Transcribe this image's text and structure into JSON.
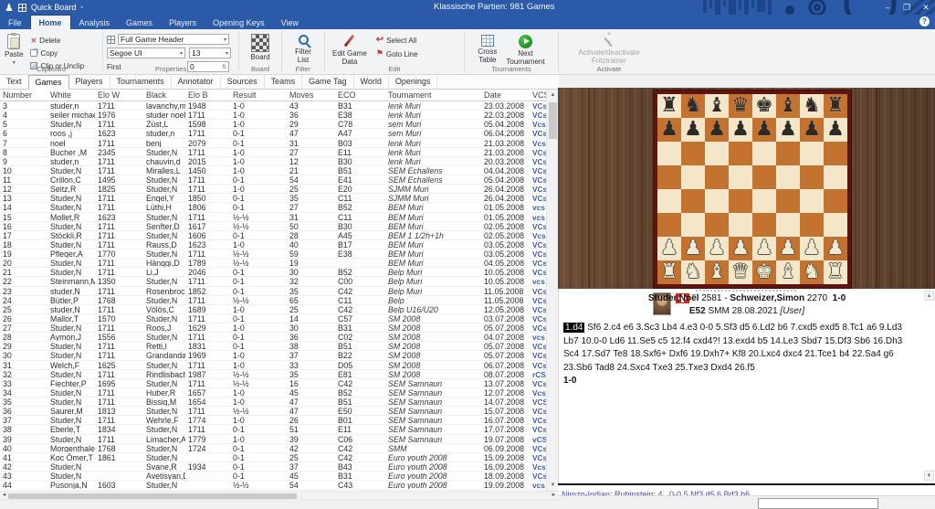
{
  "titlebar": {
    "app_title": "Quick Board",
    "doc_title": "Klassische Partien:  981 Games",
    "minimize": "–",
    "restore": "❐",
    "close": "✕",
    "help": "?"
  },
  "ribbon": {
    "tabs": [
      "File",
      "Home",
      "Analysis",
      "Games",
      "Players",
      "Opening Keys",
      "View"
    ],
    "clipboard": {
      "group": "Clipboard",
      "paste": "Paste",
      "delete": "Delete",
      "copy": "Copy",
      "clip": "Clip or Unclip"
    },
    "properties": {
      "group": "Properties",
      "header_combo": "Full Game Header",
      "font_combo": "Segoe UI",
      "size_combo": "13",
      "first_label": "First",
      "first_value": "0"
    },
    "board": {
      "group": "Board",
      "button": "Board"
    },
    "filter": {
      "group": "Filter",
      "line1": "Filter",
      "line2": "List"
    },
    "edit": {
      "group": "Edit",
      "egd1": "Edit Game",
      "egd2": "Data",
      "select_all": "Select All",
      "goto_line": "Goto Line"
    },
    "tournaments": {
      "group": "Tournaments",
      "ct1": "Cross",
      "ct2": "Table",
      "nt1": "Next",
      "nt2": "Tournament"
    },
    "activate": {
      "group": "Activate",
      "line1": "Activate/deactivate",
      "line2": "Fritztrainer"
    }
  },
  "list_tabs": {
    "items": [
      "Text",
      "Games",
      "Players",
      "Tournaments",
      "Annotator",
      "Sources",
      "Teams",
      "Game Tag",
      "World",
      "Openings"
    ]
  },
  "games_table": {
    "columns": [
      "Number",
      "White",
      "Elo W",
      "Black",
      "Elo B",
      "Result",
      "Moves",
      "ECO",
      "Tournament",
      "Date",
      "VCS"
    ],
    "rows": [
      [
        "3",
        "studer,n",
        "1711",
        "lavanchy,m",
        "1948",
        "1-0",
        "43",
        "B31",
        "lenk Muri",
        "23.03.2008",
        "VCs"
      ],
      [
        "4",
        "seiler michael",
        "1976",
        "studer noel",
        "1711",
        "1-0",
        "36",
        "E38",
        "lenk Muri",
        "22.03.2008",
        "VCs"
      ],
      [
        "5",
        "Studer,N",
        "1711",
        "Züst,L",
        "1598",
        "1-0",
        "29",
        "C78",
        "sem Muri",
        "05.04.2008",
        "Vcs"
      ],
      [
        "6",
        "roos ,j",
        "1623",
        "studer,n",
        "1711",
        "0-1",
        "47",
        "A47",
        "sem Muri",
        "06.04.2008",
        "VCs"
      ],
      [
        "7",
        "noel",
        "1711",
        "benj",
        "2079",
        "0-1",
        "31",
        "B03",
        "lenk Muri",
        "21.03.2008",
        "Vcs"
      ],
      [
        "8",
        "Bucher ,M",
        "2345",
        "Studer,N",
        "1711",
        "1-0",
        "27",
        "E11",
        "lenk Muri",
        "21.03.2008",
        "VCs"
      ],
      [
        "9",
        "studer,n",
        "1711",
        "chauvin,d",
        "2015",
        "1-0",
        "12",
        "B30",
        "lenk Muri",
        "20.03.2008",
        "VCs"
      ],
      [
        "10",
        "Studer,N",
        "1711",
        "Miralles,L",
        "1450",
        "1-0",
        "21",
        "B51",
        "SEM Echallens",
        "04.04.2008",
        "VCs"
      ],
      [
        "11",
        "Crillon,C",
        "1495",
        "Studer,N",
        "1711",
        "0-1",
        "54",
        "E41",
        "SEM Echallens",
        "05.04.2008",
        "VCs"
      ],
      [
        "12",
        "Seitz,R",
        "1825",
        "Studer,N",
        "1711",
        "1-0",
        "25",
        "E20",
        "SJMM Muri",
        "26.04.2008",
        "VCs"
      ],
      [
        "13",
        "Studer,N",
        "1711",
        "Engel,Y",
        "1850",
        "0-1",
        "35",
        "C11",
        "SJMM Muri",
        "26.04.2008",
        "VCs"
      ],
      [
        "14",
        "Studer,N",
        "1711",
        "Lüthi,H",
        "1806",
        "0-1",
        "27",
        "B52",
        "BEM Muri",
        "01.05.2008",
        "vcs"
      ],
      [
        "15",
        "Mollet,R",
        "1623",
        "Studer,N",
        "1711",
        "½-½",
        "31",
        "C11",
        "BEM Muri",
        "01.05.2008",
        "vcs"
      ],
      [
        "16",
        "Studer,N",
        "1711",
        "Senfter,D",
        "1617",
        "½-½",
        "50",
        "B30",
        "BEM Muri",
        "02.05.2008",
        "VCs"
      ],
      [
        "17",
        "Stöckli,R",
        "1711",
        "Studer,N",
        "1606",
        "0-1",
        "28",
        "A45",
        "BEM 1 1/2h+1h",
        "02.05.2008",
        "Vcs"
      ],
      [
        "18",
        "Studer,N",
        "1711",
        "Rauss,D",
        "1623",
        "1-0",
        "40",
        "B17",
        "BEM Muri",
        "03.05.2008",
        "VCs"
      ],
      [
        "19",
        "Pfleger,A",
        "1770",
        "Studer,N",
        "1711",
        "½-½",
        "59",
        "E38",
        "BEM Muri",
        "03.05.2008",
        "VCs"
      ],
      [
        "20",
        "Studer,N",
        "1711",
        "Hänggi,D",
        "1789",
        "½-½",
        "19",
        "",
        "BEM Muri",
        "04.05.2008",
        "VCs"
      ],
      [
        "21",
        "Studer,N",
        "1711",
        "Li,J",
        "2046",
        "0-1",
        "30",
        "B52",
        "Belp Muri",
        "10.05.2008",
        "VCs"
      ],
      [
        "22",
        "Steinmann,M",
        "1350",
        "Studer,N",
        "1711",
        "0-1",
        "32",
        "C00",
        "Belp Muri",
        "10.05.2008",
        "vcs"
      ],
      [
        "23",
        "studer,N",
        "1711",
        "Rosenbrock,T",
        "1852",
        "0-1",
        "35",
        "C42",
        "Belp Muri",
        "11.05.2008",
        "VCs"
      ],
      [
        "24",
        "Bütler,P",
        "1768",
        "Studer,N",
        "1711",
        "½-½",
        "65",
        "C11",
        "Belp",
        "11.05.2008",
        "VCs"
      ],
      [
        "25",
        "studer,N",
        "1711",
        "Völös,C",
        "1689",
        "1-0",
        "25",
        "C42",
        "Belp U16/U20",
        "12.05.2008",
        "VCs"
      ],
      [
        "26",
        "Mallor,T",
        "1570",
        "Studer,N",
        "1711",
        "0-1",
        "14",
        "C57",
        "SM 2008",
        "03.07.2008",
        "VCs"
      ],
      [
        "27",
        "Studer,N",
        "1711",
        "Roos,J",
        "1629",
        "1-0",
        "30",
        "B31",
        "SM 2008",
        "05.07.2008",
        "VCs"
      ],
      [
        "28",
        "Aymon,J",
        "1556",
        "Studer,N",
        "1711",
        "0-1",
        "36",
        "C02",
        "SM 2008",
        "04.07.2008",
        "vcs"
      ],
      [
        "29",
        "Studer,N",
        "1711",
        "Retti,I",
        "1831",
        "0-1",
        "38",
        "B51",
        "SM 2008",
        "05.07.2008",
        "VCs"
      ],
      [
        "30",
        "Studer,N",
        "1711",
        "Grandandam,P",
        "1969",
        "1-0",
        "37",
        "B22",
        "SM 2008",
        "05.07.2008",
        "VCs"
      ],
      [
        "31",
        "Welch,F",
        "1625",
        "Studer,N",
        "1711",
        "1-0",
        "33",
        "D05",
        "SM 2008",
        "06.07.2008",
        "VCs"
      ],
      [
        "32",
        "Studer,N",
        "1711",
        "Rindlisbacher,L",
        "1987",
        "½-½",
        "35",
        "E81",
        "SM 2008",
        "08.07.2008",
        "rCS"
      ],
      [
        "33",
        "Fiechter,P",
        "1695",
        "Studer,N",
        "1711",
        "½-½",
        "16",
        "C42",
        "SEM Samnaun",
        "13.07.2008",
        "VCs"
      ],
      [
        "34",
        "Studer,N",
        "1711",
        "Huber,R",
        "1657",
        "1-0",
        "45",
        "B52",
        "SEM Samnaun",
        "12.07.2008",
        "Vcs"
      ],
      [
        "35",
        "Studer,N",
        "1711",
        "Bissig,M",
        "1654",
        "1-0",
        "47",
        "B51",
        "SEM Samnaun",
        "14.07.2008",
        "VCS"
      ],
      [
        "36",
        "Saurer,M",
        "1813",
        "Studer,N",
        "1711",
        "½-½",
        "47",
        "E50",
        "SEM Samnaun",
        "15.07.2008",
        "VCs"
      ],
      [
        "37",
        "Studer,N",
        "1711",
        "Wehrle,F",
        "1774",
        "1-0",
        "26",
        "B01",
        "SEM Samnaun",
        "16.07.2008",
        "VCs"
      ],
      [
        "38",
        "Eberle,T",
        "1834",
        "Studer,N",
        "1711",
        "0-1",
        "51",
        "E11",
        "SEM Samnaun",
        "17.07.2008",
        "VCs"
      ],
      [
        "39",
        "Studer,N",
        "1711",
        "Limacher,A",
        "1779",
        "1-0",
        "39",
        "C06",
        "SEM Samnaun",
        "19.07.2008",
        "vCS"
      ],
      [
        "40",
        "Morgenthaler,S",
        "1768",
        "Studer,N",
        "1724",
        "0-1",
        "42",
        "C42",
        "SMM",
        "06.09.2008",
        "VCs"
      ],
      [
        "41",
        "Koc Ömer,T",
        "1861",
        "Studer,N",
        "",
        "0-1",
        "25",
        "C42",
        "Euro youth 2008",
        "15.09.2008",
        "VCs"
      ],
      [
        "42",
        "Studer,N",
        "",
        "Svane,R",
        "1934",
        "0-1",
        "37",
        "B43",
        "Euro youth 2008",
        "16.09.2008",
        "Vcs"
      ],
      [
        "43",
        "Studer,N",
        "",
        "Avetisyan,D",
        "",
        "0-1",
        "45",
        "B31",
        "Euro youth 2008",
        "18.09.2008",
        "VCs"
      ],
      [
        "44",
        "Pusonja,N",
        "1603",
        "Studer,N",
        "",
        "½-½",
        "54",
        "C43",
        "Euro youth 2008",
        "19.09.2008",
        "vcs"
      ]
    ]
  },
  "board_panel": {
    "ranks": [
      "rnbqkbnr",
      "pppppppp",
      "........",
      "........",
      "........",
      "........",
      "PPPPPPPP",
      "RNBQKBNR"
    ],
    "light_color": "#f4e6c8",
    "dark_color": "#c4722f",
    "border_color": "#5e1511"
  },
  "game_header": {
    "white": "Studer,Noël",
    "white_elo": "2581",
    "sep": "-",
    "black": "Schweizer,Simon",
    "black_elo": "2270",
    "result": "1-0",
    "eco": "E52",
    "event": "SMM 28.08.2021",
    "annotator": "[User]"
  },
  "notation": {
    "selected_move": "1.d4",
    "moves": " Sf6 2.c4 e6 3.Sc3 Lb4 4.e3 0-0 5.Sf3 d5 6.Ld2 b6 7.cxd5 exd5 8.Tc1 a6 9.Ld3 Lb7 10.0-0 Ld6 11.Se5 c5 12.f4 cxd4?! 13.exd4 b5 14.Le3 Sbd7 15.Df3 Sb6 16.Dh3 Sc4 17.Sd7 Te8 18.Sxf6+ Dxf6 19.Dxh7+ Kf8 20.Lxc4 dxc4 21.Tce1 b4 22.Sa4 g6 23.Sb6 Tad8 24.Sxc4 Txe3 25.Txe3 Dxd4 26.f5",
    "result": "1-0"
  },
  "opening_bar": {
    "text": "Nimzo-Indian: Rubinstein: 4...0-0 5 Nf3 d5 6 Bd3 b6"
  }
}
